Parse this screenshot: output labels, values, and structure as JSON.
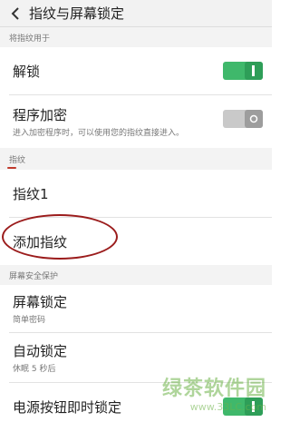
{
  "header": {
    "title": "指纹与屏幕锁定"
  },
  "sections": {
    "fingerprint_use": "将指纹用于",
    "fingerprints": "指纹",
    "screen_security": "屏幕安全保护"
  },
  "rows": {
    "unlock": {
      "label": "解锁",
      "state": "on"
    },
    "app_encrypt": {
      "label": "程序加密",
      "sublabel": "进入加密程序时，可以使用您的指纹直接进入。",
      "state": "off"
    },
    "fingerprint1": {
      "label": "指纹1"
    },
    "add_fingerprint": {
      "label": "添加指纹"
    },
    "screen_lock": {
      "label": "屏幕锁定",
      "sublabel": "简单密码"
    },
    "auto_lock": {
      "label": "自动锁定",
      "sublabel": "休眠 5 秒后"
    },
    "power_button_lock": {
      "label": "电源按钮即时锁定",
      "state": "on"
    }
  },
  "watermark": {
    "main": "绿茶软件园",
    "sub": "www.33LC.com"
  },
  "colors": {
    "toggle_on": "#3fb86b",
    "toggle_off": "#c9c9c9",
    "annotation": "#9b1c1c"
  }
}
